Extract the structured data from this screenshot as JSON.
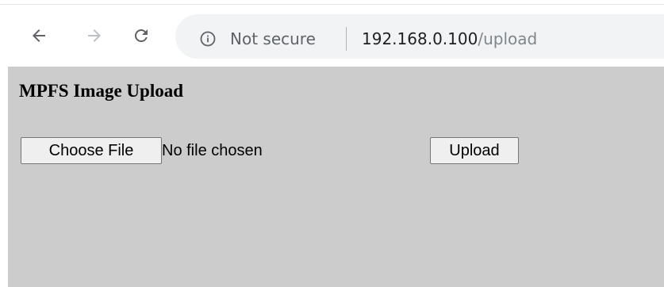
{
  "browser": {
    "back_icon": "arrow-left-icon",
    "forward_icon": "arrow-right-icon",
    "reload_icon": "reload-icon",
    "info_icon": "info-circle-icon",
    "security_label": "Not secure",
    "url_host": "192.168.0.100",
    "url_path": "/upload",
    "colors": {
      "icon_active": "#5f6368",
      "icon_disabled": "#bdc1c6",
      "omnibox_bg": "#f1f3f4"
    }
  },
  "page": {
    "title": "MPFS Image Upload",
    "file_input": {
      "button_label": "Choose File",
      "status_text": "No file chosen"
    },
    "upload_button_label": "Upload",
    "colors": {
      "background": "#cccccc",
      "button_bg": "#efefef"
    }
  }
}
